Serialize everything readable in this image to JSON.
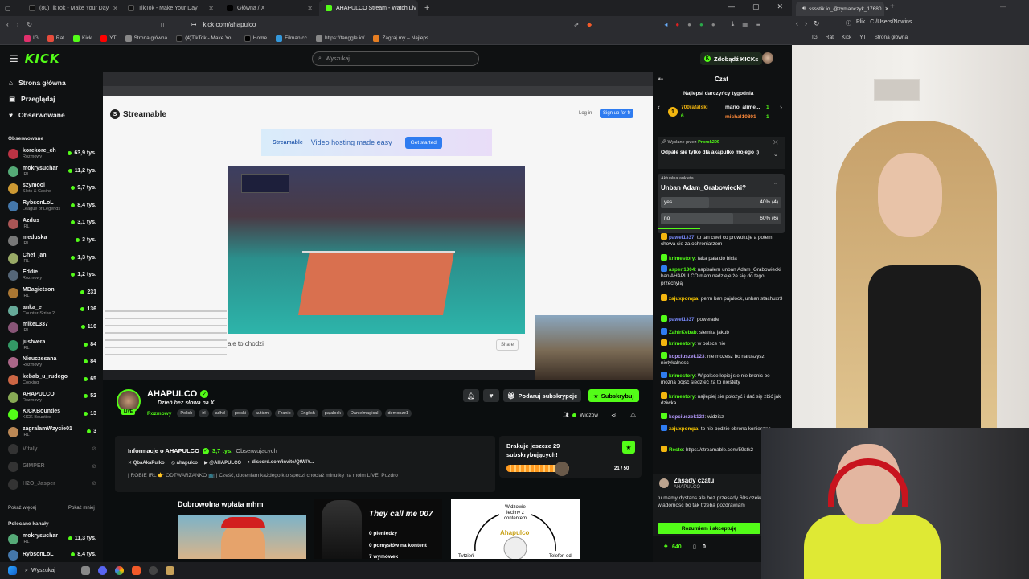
{
  "browser": {
    "tabs": [
      {
        "label": "(80)TikTok - Make Your Day",
        "active": false
      },
      {
        "label": "TikTok - Make Your Day",
        "active": false
      },
      {
        "label": "Główna / X",
        "active": false
      },
      {
        "label": "AHAPULCO Stream - Watch Liv",
        "active": true
      }
    ],
    "url": "kick.com/ahapulco",
    "bookmarks": [
      "IG",
      "Rat",
      "Kick",
      "YT",
      "Strona główna",
      "(4)TikTok - Make Yo...",
      "Home",
      "Filman.cc",
      "https://tanggle.io/",
      "Zagraj.my – Najleps..."
    ]
  },
  "kick": {
    "logo": "KICK",
    "search_placeholder": "Wyszukaj",
    "get_kicks": "Zdobądź KICKs",
    "nav": [
      {
        "label": "Strona główna",
        "icon": "home-icon"
      },
      {
        "label": "Przeglądaj",
        "icon": "browse-icon"
      },
      {
        "label": "Obserwowane",
        "icon": "heart-icon"
      }
    ],
    "followed_title": "Obserwowane",
    "followed": [
      {
        "name": "korekore_ch",
        "category": "Rozmowy",
        "viewers": "63,9 tys."
      },
      {
        "name": "mokrysuchar",
        "category": "IRL",
        "viewers": "11,2 tys."
      },
      {
        "name": "szymool",
        "category": "Slots & Casino",
        "viewers": "9,7 tys."
      },
      {
        "name": "RybsonLoL",
        "category": "League of Legends",
        "viewers": "8,4 tys."
      },
      {
        "name": "Azdus",
        "category": "IRL",
        "viewers": "3,1 tys."
      },
      {
        "name": "meduska",
        "category": "IRL",
        "viewers": "3 tys."
      },
      {
        "name": "Chef_jan",
        "category": "IRL",
        "viewers": "1,3 tys."
      },
      {
        "name": "Eddie",
        "category": "Rozmowy",
        "viewers": "1,2 tys."
      },
      {
        "name": "MBagietson",
        "category": "IRL",
        "viewers": "231"
      },
      {
        "name": "anka_e",
        "category": "Counter-Strike 2",
        "viewers": "136"
      },
      {
        "name": "mikeL337",
        "category": "IRL",
        "viewers": "110"
      },
      {
        "name": "justwera",
        "category": "IRL",
        "viewers": "84"
      },
      {
        "name": "Nieuczesana",
        "category": "Rozmowy",
        "viewers": "84"
      },
      {
        "name": "kebab_u_rudego",
        "category": "Cooking",
        "viewers": "65"
      },
      {
        "name": "AHAPULCO",
        "category": "Rozmowy",
        "viewers": "52"
      },
      {
        "name": "KICKBounties",
        "category": "KICK Bounties",
        "viewers": "13"
      },
      {
        "name": "zagralamWzycie01",
        "category": "IRL",
        "viewers": "3"
      }
    ],
    "offline": [
      "Vitaly",
      "GIMPER",
      "H2O_Jasper"
    ],
    "show_more": "Pokaż więcej",
    "show_less": "Pokaż mniej",
    "recommended_title": "Polecane kanały",
    "recommended": [
      {
        "name": "mokrysuchar",
        "category": "IRL",
        "viewers": "11,3 tys."
      },
      {
        "name": "RybsonLoL",
        "category": "",
        "viewers": "8,4 tys."
      }
    ]
  },
  "video": {
    "site": "Streamable",
    "banner": "Video hosting made easy",
    "get_started": "Get started",
    "login": "Log in",
    "signup": "Sign up for fr",
    "caption": "ale to chodzi",
    "share": "Share"
  },
  "channel": {
    "name": "AHAPULCO",
    "title": "Dzień bez słowa na X",
    "category": "Rozmowy",
    "tags": [
      "Polish",
      "irl",
      "adhd",
      "polski",
      "autism",
      "Franio",
      "English",
      "pajalock",
      "Danielmagical",
      "demonzz1"
    ],
    "gift_sub": "Podaruj subskrypcje",
    "subscribe": "Subskrybuj",
    "viewers_label": "Widzów",
    "live": "LIVE"
  },
  "about": {
    "title": "Informacje o AHAPULCO",
    "followers": "3,7 tys.",
    "followers_label": "Obserwujących",
    "socials": [
      "QbaAkaPulko",
      "ahapulco",
      "@AHAPULCO",
      "discord.com/invite/QtWlY..."
    ],
    "bio": "| ROBIĘ IRL 👉 ODTWARZANKO 📺 | Cześć, doceniam każdego kto spędzi chociaż minutkę na moim LIVE! Pozdro"
  },
  "goal": {
    "title": "Brakuje jeszcze 29 subskrybujących!",
    "count": "21 / 50",
    "progress": 0.42
  },
  "panels": {
    "title": "Dobrowolna wpłata mhm",
    "p2_title": "They call me 007",
    "p2_lines": [
      "0 pieniędzy",
      "0 pomysłów na kontent",
      "7 wymówek"
    ],
    "p3_text": "Widzowie lecimy z contentem",
    "p3_brand": "Ahapulco",
    "p3_left": "Tvtzień",
    "p3_right": "Telefon od"
  },
  "chat": {
    "title": "Czat",
    "gifters_title": "Najlepsi darczyńcy tygodnia",
    "gifters": [
      {
        "name": "700rafalski",
        "count": "6"
      },
      {
        "name": "mario_alime...",
        "count": "1"
      },
      {
        "name": "michal10801",
        "count": "1"
      }
    ],
    "pinned_by": "Wysłane przez",
    "pinned_user": "Prorok209",
    "pinned_text": "Odpale sie tylko dla akapulko mojego :)",
    "poll_label": "Aktualna ankieta",
    "poll_question": "Unban Adam_Grabowiecki?",
    "poll_options": [
      {
        "label": "yes",
        "pct": "40% (4)",
        "fraction": 0.4
      },
      {
        "label": "no",
        "pct": "60% (6)",
        "fraction": 0.6
      }
    ],
    "messages": [
      {
        "user": "pawel1337",
        "color": "#7b8cff",
        "text": "to tan cwel co prowokuje a potem chowa sie za ochroniarzem"
      },
      {
        "user": "krimestory",
        "color": "#53fc18",
        "text": "taka pała do bicia"
      },
      {
        "user": "aspen1304",
        "color": "#53fc18",
        "text": "napisałem unban Adam_Grabowiecki ban AHAPULCO mam nadzieje że się do tego przechyłą"
      },
      {
        "user": "zajuxpompa",
        "color": "#ffcc00",
        "text": "perm ban pajalock, unban stachuxr3"
      },
      {
        "user": "pawel1337",
        "color": "#7b8cff",
        "text": "powerade"
      },
      {
        "user": "ZahirKebab",
        "color": "#53fc18",
        "text": "siemka jakub"
      },
      {
        "user": "krimestory",
        "color": "#53fc18",
        "text": "w polsce nie"
      },
      {
        "user": "kopciuszek123",
        "color": "#b69bff",
        "text": "nie mozesz bo naruszysz nietykalnosc"
      },
      {
        "user": "krimestory",
        "color": "#53fc18",
        "text": "W polsce lepiej sie nie bronic bo można pójść siedzieć za to niestety"
      },
      {
        "user": "krimestory",
        "color": "#53fc18",
        "text": "najlepiej sie położyć i dać się zbić jak dziwka"
      },
      {
        "user": "kopciuszek123",
        "color": "#b69bff",
        "text": "widzisz"
      },
      {
        "user": "zajuxpompa",
        "color": "#ffcc00",
        "text": "to nie będzie obrona konieczna"
      },
      {
        "user": "Resto",
        "color": "#53fc18",
        "text": "https://streamable.com/59stk2"
      }
    ],
    "rules_title": "Zasady czatu",
    "rules_owner": "AHAPULCO",
    "rules_text": "tu mamy dystans ale bez przesady 60s czekania na wiadomosc bo tak trzeba pozdrawiam",
    "accept": "Rozumiem i akceptuję",
    "kicks": "640",
    "zero": "0"
  },
  "right_browser": {
    "tab": "sssstik.io_@zymanczyk_17680",
    "url": "C:/Users/Nowins...",
    "file_label": "Plik",
    "bookmarks": [
      "IG",
      "Rat",
      "Kick",
      "YT",
      "Strona główna"
    ]
  },
  "taskbar": {
    "search": "Wyszukaj"
  },
  "colors": {
    "kick_green": "#53fc18",
    "background": "#0b0e0f"
  }
}
